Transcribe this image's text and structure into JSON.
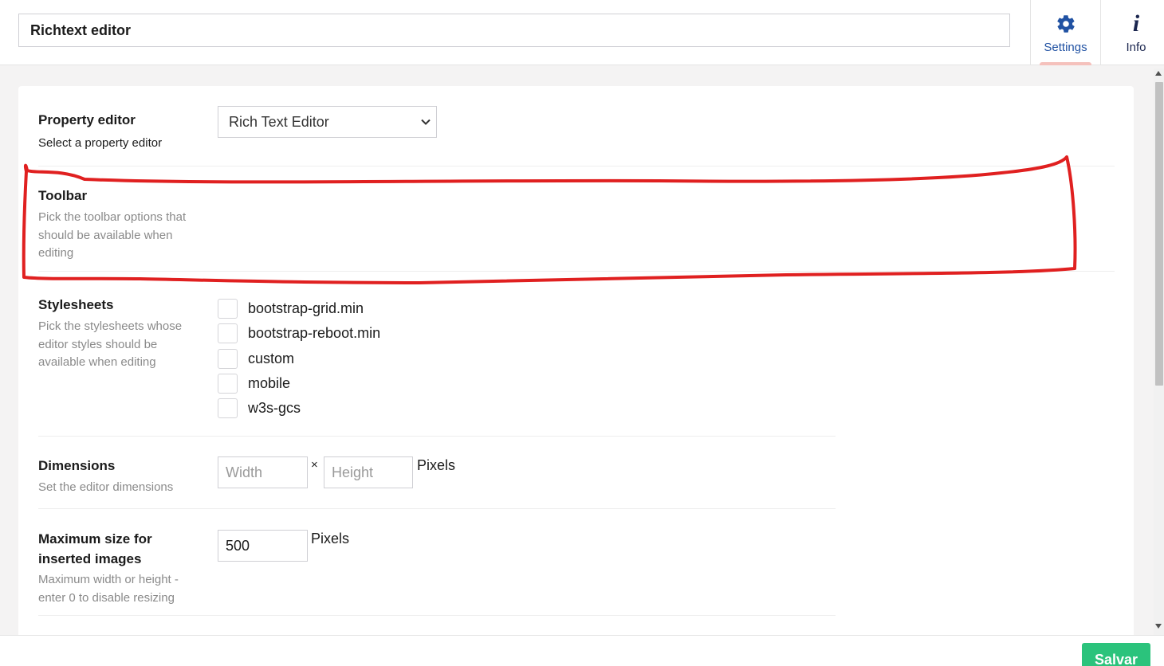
{
  "header": {
    "name_value": "Richtext editor",
    "apps": [
      {
        "label": "Settings",
        "icon": "gear-icon",
        "active": true
      },
      {
        "label": "Info",
        "icon": "info-icon",
        "active": false
      }
    ]
  },
  "properties": {
    "property_editor": {
      "label": "Property editor",
      "description": "Select a property editor",
      "selected": "Rich Text Editor"
    },
    "toolbar": {
      "label": "Toolbar",
      "description": "Pick the toolbar options that should be available when editing"
    },
    "stylesheets": {
      "label": "Stylesheets",
      "description": "Pick the stylesheets whose editor styles should be available when editing",
      "options": [
        {
          "label": "bootstrap-grid.min",
          "checked": false
        },
        {
          "label": "bootstrap-reboot.min",
          "checked": false
        },
        {
          "label": "custom",
          "checked": false
        },
        {
          "label": "mobile",
          "checked": false
        },
        {
          "label": "w3s-gcs",
          "checked": false
        }
      ]
    },
    "dimensions": {
      "label": "Dimensions",
      "description": "Set the editor dimensions",
      "width_placeholder": "Width",
      "height_placeholder": "Height",
      "separator": "×",
      "unit": "Pixels"
    },
    "max_image_size": {
      "label": "Maximum size for inserted images",
      "description": "Maximum width or height - enter 0 to disable resizing",
      "value": "500",
      "unit": "Pixels"
    }
  },
  "footer": {
    "save_label": "Salvar"
  },
  "colors": {
    "accent": "#2152a3",
    "save": "#2bc37c",
    "highlight": "#e02020",
    "active_tab_indicator": "#f5c1bc"
  }
}
